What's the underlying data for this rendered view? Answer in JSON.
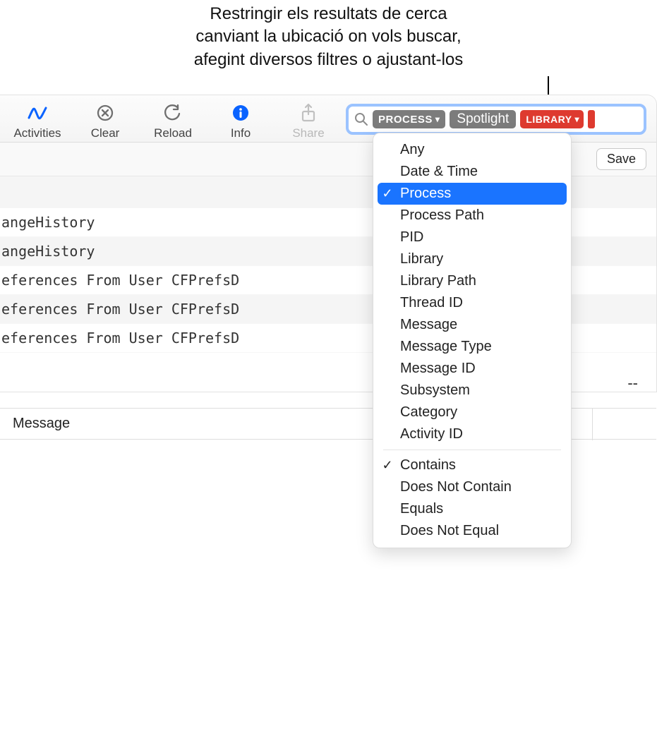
{
  "caption": "Restringir els resultats de cerca\ncanviant la ubicació on vols buscar,\nafegint diversos filtres o ajustant-los",
  "toolbar": {
    "activities": "Activities",
    "clear": "Clear",
    "reload": "Reload",
    "info": "Info",
    "share": "Share"
  },
  "search": {
    "process_token": "PROCESS",
    "spotlight": "Spotlight",
    "library_token": "LIBRARY"
  },
  "save_label": "Save",
  "rows": [
    "angeHistory",
    "angeHistory",
    "eferences From User CFPrefsD",
    "eferences From User CFPrefsD",
    "eferences From User CFPrefsD"
  ],
  "detail_placeholder": "--",
  "message_label": "Message",
  "menu": {
    "group1": [
      {
        "label": "Any",
        "checked": false
      },
      {
        "label": "Date & Time",
        "checked": false
      },
      {
        "label": "Process",
        "checked": true,
        "selected": true
      },
      {
        "label": "Process Path",
        "checked": false
      },
      {
        "label": "PID",
        "checked": false
      },
      {
        "label": "Library",
        "checked": false
      },
      {
        "label": "Library Path",
        "checked": false
      },
      {
        "label": "Thread ID",
        "checked": false
      },
      {
        "label": "Message",
        "checked": false
      },
      {
        "label": "Message Type",
        "checked": false
      },
      {
        "label": "Message ID",
        "checked": false
      },
      {
        "label": "Subsystem",
        "checked": false
      },
      {
        "label": "Category",
        "checked": false
      },
      {
        "label": "Activity ID",
        "checked": false
      }
    ],
    "group2": [
      {
        "label": "Contains",
        "checked": true
      },
      {
        "label": "Does Not Contain",
        "checked": false
      },
      {
        "label": "Equals",
        "checked": false
      },
      {
        "label": "Does Not Equal",
        "checked": false
      }
    ]
  }
}
